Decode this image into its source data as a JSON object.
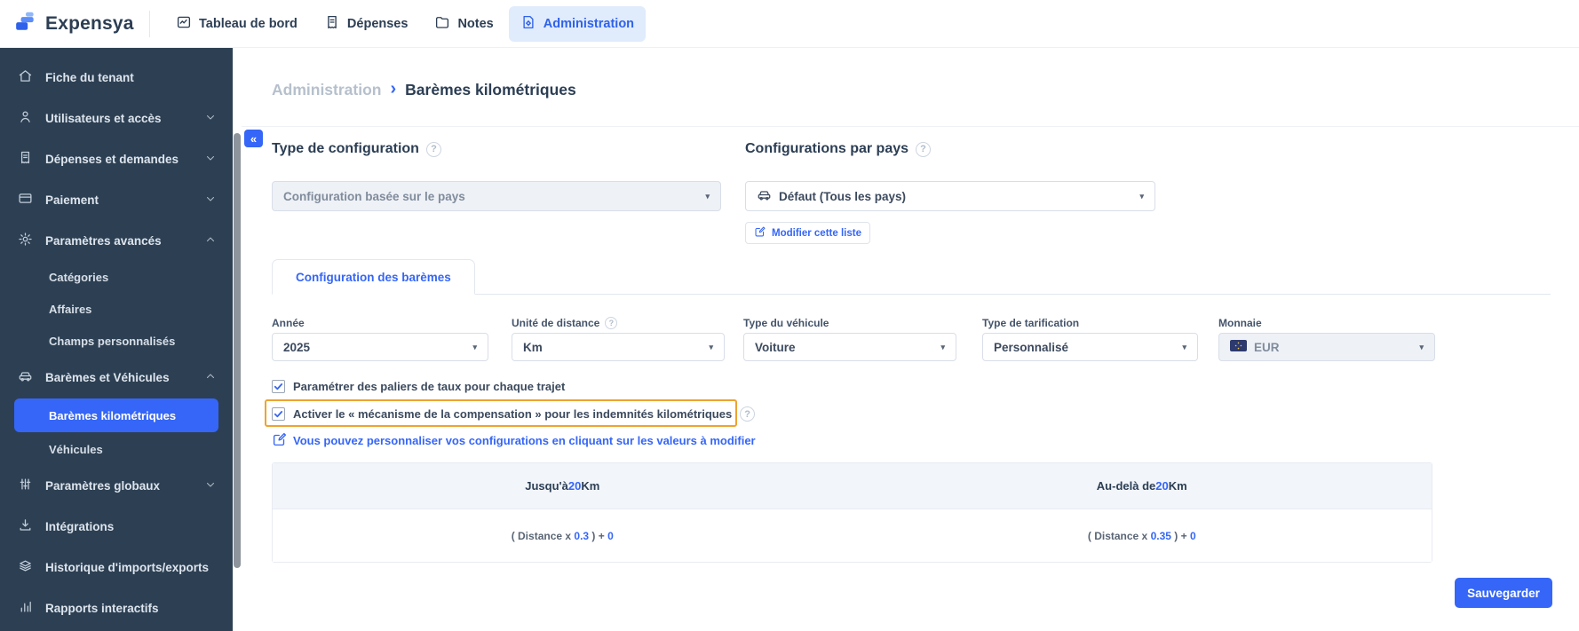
{
  "topbar": {
    "brand": "Expensya",
    "items": [
      {
        "label": "Tableau de bord",
        "active": false
      },
      {
        "label": "Dépenses",
        "active": false
      },
      {
        "label": "Notes",
        "active": false
      },
      {
        "label": "Administration",
        "active": true
      }
    ]
  },
  "sidebar": {
    "items": [
      {
        "label": "Fiche du tenant"
      },
      {
        "label": "Utilisateurs et accès",
        "chevron": "down"
      },
      {
        "label": "Dépenses et demandes",
        "chevron": "down"
      },
      {
        "label": "Paiement",
        "chevron": "down"
      },
      {
        "label": "Paramètres avancés",
        "chevron": "up"
      },
      {
        "label": "Catégories",
        "sub": true
      },
      {
        "label": "Affaires",
        "sub": true
      },
      {
        "label": "Champs personnalisés",
        "sub": true
      },
      {
        "label": "Barèmes et Véhicules",
        "chevron": "up"
      },
      {
        "label": "Barèmes kilométriques",
        "sub": true,
        "active": true
      },
      {
        "label": "Véhicules",
        "sub": true
      },
      {
        "label": "Paramètres globaux",
        "chevron": "down"
      },
      {
        "label": "Intégrations"
      },
      {
        "label": "Historique d'imports/exports"
      },
      {
        "label": "Rapports interactifs"
      }
    ]
  },
  "breadcrumb": {
    "parent": "Administration",
    "separator": "›",
    "current": "Barèmes kilométriques"
  },
  "collapse_button": "«",
  "sections": {
    "config_type": {
      "title": "Type de configuration",
      "selected": "Configuration basée sur le pays"
    },
    "config_country": {
      "title": "Configurations par pays",
      "selected": "Défaut (Tous les pays)",
      "edit_button": "Modifier cette liste"
    }
  },
  "tabs": {
    "active": "Configuration des barèmes"
  },
  "fields": [
    {
      "label": "Année",
      "value": "2025"
    },
    {
      "label": "Unité de distance",
      "value": "Km",
      "help": true
    },
    {
      "label": "Type du véhicule",
      "value": "Voiture"
    },
    {
      "label": "Type de tarification",
      "value": "Personnalisé"
    },
    {
      "label": "Monnaie",
      "value": "EUR",
      "disabled": true
    }
  ],
  "options": [
    {
      "label": "Paramétrer des paliers de taux pour chaque trajet",
      "checked": true
    },
    {
      "label": "Activer le « mécanisme de la compensation » pour les indemnités kilométriques",
      "checked": true,
      "highlighted": true
    }
  ],
  "customize_link": "Vous pouvez personnaliser vos configurations en cliquant sur les valeurs à modifier",
  "table": {
    "columns": [
      {
        "header_pre": "Jusqu'à ",
        "header_num": "20",
        "header_post": " Km",
        "cell_pre": "( Distance x ",
        "cell_factor": "0.3",
        "cell_mid": " ) + ",
        "cell_offset": "0"
      },
      {
        "header_pre": "Au-delà de ",
        "header_num": "20",
        "header_post": " Km",
        "cell_pre": "( Distance x ",
        "cell_factor": "0.35",
        "cell_mid": " ) + ",
        "cell_offset": "0"
      }
    ]
  },
  "save_button": "Sauvegarder",
  "colors": {
    "accent": "#3566f7",
    "sidebar_bg": "#2d4053",
    "highlight_border": "#eda32f",
    "active_nav_bg": "#e0ebfc",
    "table_header_bg": "#f2f5fa"
  }
}
